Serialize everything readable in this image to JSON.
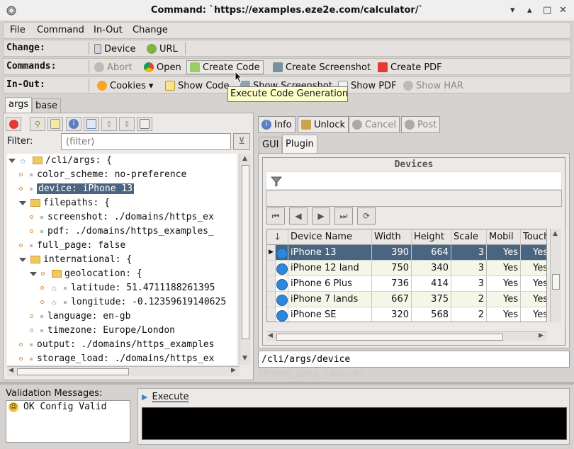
{
  "window": {
    "title": "Command: `https://examples.eze2e.com/calculator/`",
    "minimize": "▾",
    "restore": "▴",
    "maximize": "□",
    "close": "✕"
  },
  "menu": {
    "file": "File",
    "command": "Command",
    "inout": "In-Out",
    "change": "Change"
  },
  "change_row": {
    "label": "Change:",
    "device": "Device",
    "url": "URL"
  },
  "commands_row": {
    "label": "Commands:",
    "abort": "Abort",
    "open": "Open",
    "create_code": "Create Code",
    "create_screenshot": "Create Screenshot",
    "create_pdf": "Create PDF"
  },
  "inout_row": {
    "label": "In-Out:",
    "cookies": "Cookies",
    "show_code": "Show Code",
    "show_screenshot": "Show Screenshot",
    "show_pdf": "Show PDF",
    "show_har": "Show HAR"
  },
  "tooltip": "Execute Code Generation",
  "left_tabs": {
    "args": "args",
    "base": "base"
  },
  "filter": {
    "label": "Filter:",
    "placeholder": "(filter)"
  },
  "tree": [
    {
      "text": "/cli/args: {",
      "level": 0
    },
    {
      "text": "color_scheme: no-preference",
      "level": 1
    },
    {
      "text": "device: iPhone 13",
      "level": 1
    },
    {
      "text": "filepaths: {",
      "level": 1
    },
    {
      "text": "screenshot: ./domains/https_ex",
      "level": 2
    },
    {
      "text": "pdf: ./domains/https_examples_",
      "level": 2
    },
    {
      "text": "full_page: false",
      "level": 1
    },
    {
      "text": "international: {",
      "level": 1
    },
    {
      "text": "geolocation: {",
      "level": 2
    },
    {
      "text": "latitude: 51.4711188261395",
      "level": 3
    },
    {
      "text": "longitude: -0.12359619140625",
      "level": 3
    },
    {
      "text": "language: en-gb",
      "level": 2
    },
    {
      "text": "timezone: Europe/London",
      "level": 2
    },
    {
      "text": "output: ./domains/https_examples",
      "level": 1
    },
    {
      "text": "storage_load: ./domains/https_ex",
      "level": 1
    }
  ],
  "right_buttons": {
    "info": "Info",
    "unlock": "Unlock",
    "cancel": "Cancel",
    "post": "Post"
  },
  "right_tabs": {
    "gui": "GUI",
    "plugin": "Plugin"
  },
  "devices": {
    "title": "Devices",
    "columns": [
      "Device Name",
      "Width",
      "Height",
      "Scale",
      "Mobil",
      "Touch"
    ],
    "rows": [
      {
        "name": "iPhone 13",
        "width": "390",
        "height": "664",
        "scale": "3",
        "mobile": "Yes",
        "touch": "Yes"
      },
      {
        "name": "iPhone 12 land",
        "width": "750",
        "height": "340",
        "scale": "3",
        "mobile": "Yes",
        "touch": "Yes"
      },
      {
        "name": "iPhone 6 Plus",
        "width": "736",
        "height": "414",
        "scale": "3",
        "mobile": "Yes",
        "touch": "Yes"
      },
      {
        "name": "iPhone 7 lands",
        "width": "667",
        "height": "375",
        "scale": "2",
        "mobile": "Yes",
        "touch": "Yes"
      },
      {
        "name": "iPhone SE",
        "width": "320",
        "height": "568",
        "scale": "2",
        "mobile": "Yes",
        "touch": "Yes"
      }
    ]
  },
  "path_field": "/cli/args/device",
  "ghost_label": "Tframe_jprop_sdevices",
  "validation": {
    "label": "Validation Messages:",
    "message": "OK Config Valid"
  },
  "execute": {
    "label": "Execute"
  }
}
